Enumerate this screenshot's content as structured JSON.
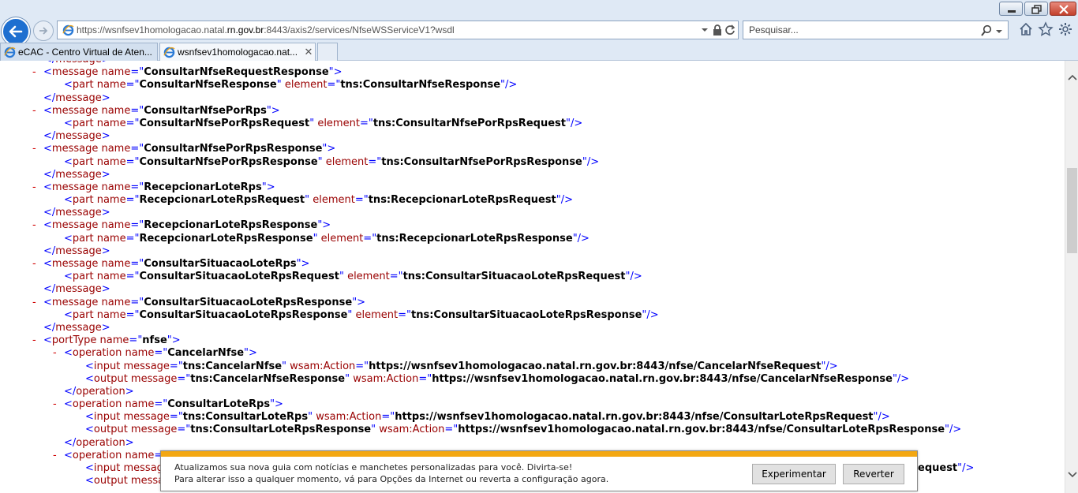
{
  "browser": {
    "url_prefix": "https://wsnfsev1homologacao.natal.",
    "url_domain": "rn.gov.br",
    "url_suffix": ":8443/axis2/services/NfseWSServiceV1?wsdl",
    "search_placeholder": "Pesquisar...",
    "tabs": [
      {
        "label": "eCAC - Centro Virtual de Aten..."
      },
      {
        "label": "wsnfsev1homologacao.nat..."
      }
    ],
    "tab_close": "✕"
  },
  "xml_lines": [
    {
      "indent": 1,
      "minus": false,
      "parts": [
        [
          "b",
          "</"
        ],
        [
          "t",
          "message"
        ],
        [
          "b",
          ">"
        ]
      ]
    },
    {
      "indent": 1,
      "minus": true,
      "parts": [
        [
          "b",
          "<"
        ],
        [
          "t",
          "message"
        ],
        [
          "a",
          " name"
        ],
        [
          "b",
          "=\""
        ],
        [
          "v",
          "ConsultarNfseRequestResponse"
        ],
        [
          "b",
          "\">"
        ]
      ]
    },
    {
      "indent": 2,
      "minus": false,
      "parts": [
        [
          "b",
          "<"
        ],
        [
          "t",
          "part"
        ],
        [
          "a",
          " name"
        ],
        [
          "b",
          "=\""
        ],
        [
          "v",
          "ConsultarNfseResponse"
        ],
        [
          "b",
          "\""
        ],
        [
          "a",
          " element"
        ],
        [
          "b",
          "=\""
        ],
        [
          "v",
          "tns:ConsultarNfseResponse"
        ],
        [
          "b",
          "\"/>"
        ]
      ]
    },
    {
      "indent": 1,
      "minus": false,
      "parts": [
        [
          "b",
          "</"
        ],
        [
          "t",
          "message"
        ],
        [
          "b",
          ">"
        ]
      ]
    },
    {
      "indent": 1,
      "minus": true,
      "parts": [
        [
          "b",
          "<"
        ],
        [
          "t",
          "message"
        ],
        [
          "a",
          " name"
        ],
        [
          "b",
          "=\""
        ],
        [
          "v",
          "ConsultarNfsePorRps"
        ],
        [
          "b",
          "\">"
        ]
      ]
    },
    {
      "indent": 2,
      "minus": false,
      "parts": [
        [
          "b",
          "<"
        ],
        [
          "t",
          "part"
        ],
        [
          "a",
          " name"
        ],
        [
          "b",
          "=\""
        ],
        [
          "v",
          "ConsultarNfsePorRpsRequest"
        ],
        [
          "b",
          "\""
        ],
        [
          "a",
          " element"
        ],
        [
          "b",
          "=\""
        ],
        [
          "v",
          "tns:ConsultarNfsePorRpsRequest"
        ],
        [
          "b",
          "\"/>"
        ]
      ]
    },
    {
      "indent": 1,
      "minus": false,
      "parts": [
        [
          "b",
          "</"
        ],
        [
          "t",
          "message"
        ],
        [
          "b",
          ">"
        ]
      ]
    },
    {
      "indent": 1,
      "minus": true,
      "parts": [
        [
          "b",
          "<"
        ],
        [
          "t",
          "message"
        ],
        [
          "a",
          " name"
        ],
        [
          "b",
          "=\""
        ],
        [
          "v",
          "ConsultarNfsePorRpsResponse"
        ],
        [
          "b",
          "\">"
        ]
      ]
    },
    {
      "indent": 2,
      "minus": false,
      "parts": [
        [
          "b",
          "<"
        ],
        [
          "t",
          "part"
        ],
        [
          "a",
          " name"
        ],
        [
          "b",
          "=\""
        ],
        [
          "v",
          "ConsultarNfsePorRpsResponse"
        ],
        [
          "b",
          "\""
        ],
        [
          "a",
          " element"
        ],
        [
          "b",
          "=\""
        ],
        [
          "v",
          "tns:ConsultarNfsePorRpsResponse"
        ],
        [
          "b",
          "\"/>"
        ]
      ]
    },
    {
      "indent": 1,
      "minus": false,
      "parts": [
        [
          "b",
          "</"
        ],
        [
          "t",
          "message"
        ],
        [
          "b",
          ">"
        ]
      ]
    },
    {
      "indent": 1,
      "minus": true,
      "parts": [
        [
          "b",
          "<"
        ],
        [
          "t",
          "message"
        ],
        [
          "a",
          " name"
        ],
        [
          "b",
          "=\""
        ],
        [
          "v",
          "RecepcionarLoteRps"
        ],
        [
          "b",
          "\">"
        ]
      ]
    },
    {
      "indent": 2,
      "minus": false,
      "parts": [
        [
          "b",
          "<"
        ],
        [
          "t",
          "part"
        ],
        [
          "a",
          " name"
        ],
        [
          "b",
          "=\""
        ],
        [
          "v",
          "RecepcionarLoteRpsRequest"
        ],
        [
          "b",
          "\""
        ],
        [
          "a",
          " element"
        ],
        [
          "b",
          "=\""
        ],
        [
          "v",
          "tns:RecepcionarLoteRpsRequest"
        ],
        [
          "b",
          "\"/>"
        ]
      ]
    },
    {
      "indent": 1,
      "minus": false,
      "parts": [
        [
          "b",
          "</"
        ],
        [
          "t",
          "message"
        ],
        [
          "b",
          ">"
        ]
      ]
    },
    {
      "indent": 1,
      "minus": true,
      "parts": [
        [
          "b",
          "<"
        ],
        [
          "t",
          "message"
        ],
        [
          "a",
          " name"
        ],
        [
          "b",
          "=\""
        ],
        [
          "v",
          "RecepcionarLoteRpsResponse"
        ],
        [
          "b",
          "\">"
        ]
      ]
    },
    {
      "indent": 2,
      "minus": false,
      "parts": [
        [
          "b",
          "<"
        ],
        [
          "t",
          "part"
        ],
        [
          "a",
          " name"
        ],
        [
          "b",
          "=\""
        ],
        [
          "v",
          "RecepcionarLoteRpsResponse"
        ],
        [
          "b",
          "\""
        ],
        [
          "a",
          " element"
        ],
        [
          "b",
          "=\""
        ],
        [
          "v",
          "tns:RecepcionarLoteRpsResponse"
        ],
        [
          "b",
          "\"/>"
        ]
      ]
    },
    {
      "indent": 1,
      "minus": false,
      "parts": [
        [
          "b",
          "</"
        ],
        [
          "t",
          "message"
        ],
        [
          "b",
          ">"
        ]
      ]
    },
    {
      "indent": 1,
      "minus": true,
      "parts": [
        [
          "b",
          "<"
        ],
        [
          "t",
          "message"
        ],
        [
          "a",
          " name"
        ],
        [
          "b",
          "=\""
        ],
        [
          "v",
          "ConsultarSituacaoLoteRps"
        ],
        [
          "b",
          "\">"
        ]
      ]
    },
    {
      "indent": 2,
      "minus": false,
      "parts": [
        [
          "b",
          "<"
        ],
        [
          "t",
          "part"
        ],
        [
          "a",
          " name"
        ],
        [
          "b",
          "=\""
        ],
        [
          "v",
          "ConsultarSituacaoLoteRpsRequest"
        ],
        [
          "b",
          "\""
        ],
        [
          "a",
          " element"
        ],
        [
          "b",
          "=\""
        ],
        [
          "v",
          "tns:ConsultarSituacaoLoteRpsRequest"
        ],
        [
          "b",
          "\"/>"
        ]
      ]
    },
    {
      "indent": 1,
      "minus": false,
      "parts": [
        [
          "b",
          "</"
        ],
        [
          "t",
          "message"
        ],
        [
          "b",
          ">"
        ]
      ]
    },
    {
      "indent": 1,
      "minus": true,
      "parts": [
        [
          "b",
          "<"
        ],
        [
          "t",
          "message"
        ],
        [
          "a",
          " name"
        ],
        [
          "b",
          "=\""
        ],
        [
          "v",
          "ConsultarSituacaoLoteRpsResponse"
        ],
        [
          "b",
          "\">"
        ]
      ]
    },
    {
      "indent": 2,
      "minus": false,
      "parts": [
        [
          "b",
          "<"
        ],
        [
          "t",
          "part"
        ],
        [
          "a",
          " name"
        ],
        [
          "b",
          "=\""
        ],
        [
          "v",
          "ConsultarSituacaoLoteRpsResponse"
        ],
        [
          "b",
          "\""
        ],
        [
          "a",
          " element"
        ],
        [
          "b",
          "=\""
        ],
        [
          "v",
          "tns:ConsultarSituacaoLoteRpsResponse"
        ],
        [
          "b",
          "\"/>"
        ]
      ]
    },
    {
      "indent": 1,
      "minus": false,
      "parts": [
        [
          "b",
          "</"
        ],
        [
          "t",
          "message"
        ],
        [
          "b",
          ">"
        ]
      ]
    },
    {
      "indent": 1,
      "minus": true,
      "parts": [
        [
          "b",
          "<"
        ],
        [
          "t",
          "portType"
        ],
        [
          "a",
          " name"
        ],
        [
          "b",
          "=\""
        ],
        [
          "v",
          "nfse"
        ],
        [
          "b",
          "\">"
        ]
      ]
    },
    {
      "indent": 2,
      "minus": true,
      "parts": [
        [
          "b",
          "<"
        ],
        [
          "t",
          "operation"
        ],
        [
          "a",
          " name"
        ],
        [
          "b",
          "=\""
        ],
        [
          "v",
          "CancelarNfse"
        ],
        [
          "b",
          "\">"
        ]
      ]
    },
    {
      "indent": 3,
      "minus": false,
      "parts": [
        [
          "b",
          "<"
        ],
        [
          "t",
          "input"
        ],
        [
          "a",
          " message"
        ],
        [
          "b",
          "=\""
        ],
        [
          "v",
          "tns:CancelarNfse"
        ],
        [
          "b",
          "\""
        ],
        [
          "a",
          " wsam:Action"
        ],
        [
          "b",
          "=\""
        ],
        [
          "v",
          "https://wsnfsev1homologacao.natal.rn.gov.br:8443/nfse/CancelarNfseRequest"
        ],
        [
          "b",
          "\"/>"
        ]
      ]
    },
    {
      "indent": 3,
      "minus": false,
      "parts": [
        [
          "b",
          "<"
        ],
        [
          "t",
          "output"
        ],
        [
          "a",
          " message"
        ],
        [
          "b",
          "=\""
        ],
        [
          "v",
          "tns:CancelarNfseResponse"
        ],
        [
          "b",
          "\""
        ],
        [
          "a",
          " wsam:Action"
        ],
        [
          "b",
          "=\""
        ],
        [
          "v",
          "https://wsnfsev1homologacao.natal.rn.gov.br:8443/nfse/CancelarNfseResponse"
        ],
        [
          "b",
          "\"/>"
        ]
      ]
    },
    {
      "indent": 2,
      "minus": false,
      "parts": [
        [
          "b",
          "</"
        ],
        [
          "t",
          "operation"
        ],
        [
          "b",
          ">"
        ]
      ]
    },
    {
      "indent": 2,
      "minus": true,
      "parts": [
        [
          "b",
          "<"
        ],
        [
          "t",
          "operation"
        ],
        [
          "a",
          " name"
        ],
        [
          "b",
          "=\""
        ],
        [
          "v",
          "ConsultarLoteRps"
        ],
        [
          "b",
          "\">"
        ]
      ]
    },
    {
      "indent": 3,
      "minus": false,
      "parts": [
        [
          "b",
          "<"
        ],
        [
          "t",
          "input"
        ],
        [
          "a",
          " message"
        ],
        [
          "b",
          "=\""
        ],
        [
          "v",
          "tns:ConsultarLoteRps"
        ],
        [
          "b",
          "\""
        ],
        [
          "a",
          " wsam:Action"
        ],
        [
          "b",
          "=\""
        ],
        [
          "v",
          "https://wsnfsev1homologacao.natal.rn.gov.br:8443/nfse/ConsultarLoteRpsRequest"
        ],
        [
          "b",
          "\"/>"
        ]
      ]
    },
    {
      "indent": 3,
      "minus": false,
      "parts": [
        [
          "b",
          "<"
        ],
        [
          "t",
          "output"
        ],
        [
          "a",
          " message"
        ],
        [
          "b",
          "=\""
        ],
        [
          "v",
          "tns:ConsultarLoteRpsResponse"
        ],
        [
          "b",
          "\""
        ],
        [
          "a",
          " wsam:Action"
        ],
        [
          "b",
          "=\""
        ],
        [
          "v",
          "https://wsnfsev1homologacao.natal.rn.gov.br:8443/nfse/ConsultarLoteRpsResponse"
        ],
        [
          "b",
          "\"/>"
        ]
      ]
    },
    {
      "indent": 2,
      "minus": false,
      "parts": [
        [
          "b",
          "</"
        ],
        [
          "t",
          "operation"
        ],
        [
          "b",
          ">"
        ]
      ]
    },
    {
      "indent": 2,
      "minus": true,
      "parts": [
        [
          "b",
          "<"
        ],
        [
          "t",
          "operation"
        ],
        [
          "a",
          " name"
        ],
        [
          "b",
          "="
        ]
      ]
    },
    {
      "indent": 3,
      "minus": false,
      "parts": [
        [
          "b",
          "<"
        ],
        [
          "t",
          "input"
        ],
        [
          "a",
          " messag"
        ]
      ],
      "tail": [
        [
          "v",
          "equest"
        ],
        [
          "b",
          "\"/>"
        ]
      ]
    },
    {
      "indent": 3,
      "minus": false,
      "parts": [
        [
          "b",
          "<"
        ],
        [
          "t",
          "output"
        ],
        [
          "a",
          " messa"
        ]
      ]
    }
  ],
  "notification": {
    "line1": "Atualizamos sua nova guia com notícias e manchetes personalizadas para você. Divirta-se!",
    "line2": "Para alterar isso a qualquer momento, vá para Opções da Internet ou reverta a configuração agora.",
    "btn_try": "Experimentar",
    "btn_revert": "Reverter"
  },
  "colors": {
    "notification_bar": "#f3a712",
    "back_button": "#1e6fd0",
    "xml_minus": "#d00000",
    "xml_bracket": "#0000ff",
    "xml_tag": "#990000"
  }
}
